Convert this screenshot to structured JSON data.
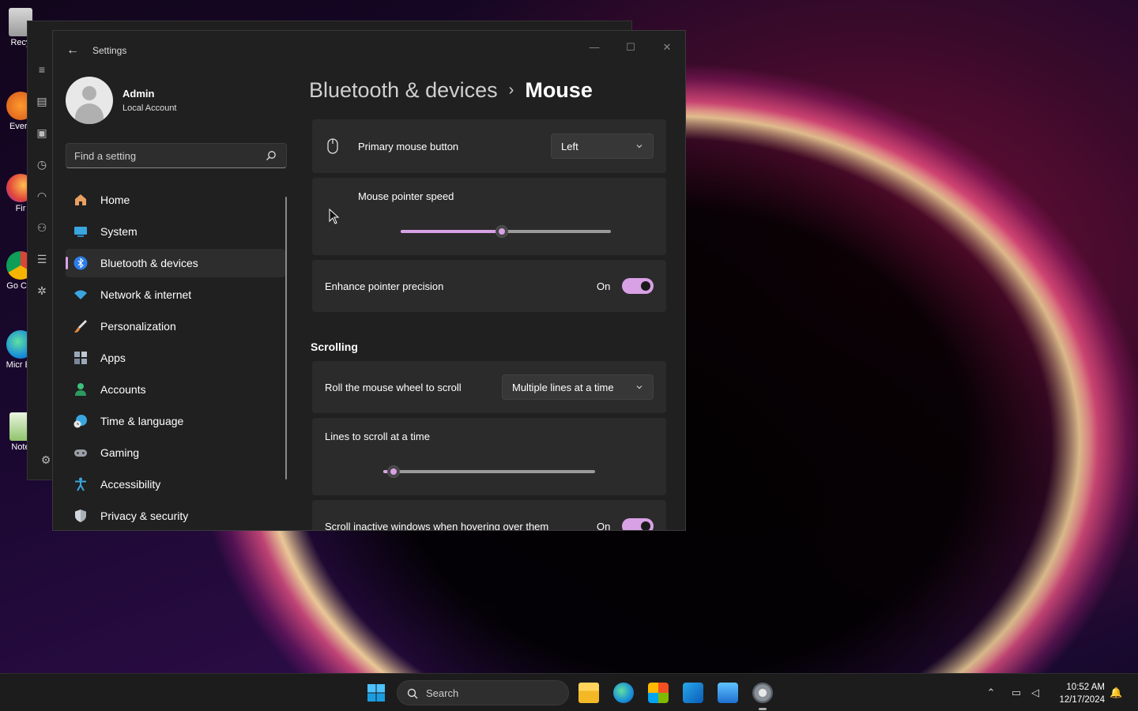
{
  "desktop": {
    "icons": [
      {
        "label": "Recy"
      },
      {
        "label": "Every"
      },
      {
        "label": "Fir"
      },
      {
        "label": "Go Chr"
      },
      {
        "label": "Micr Ec"
      },
      {
        "label": "Note"
      }
    ]
  },
  "window": {
    "title": "Settings",
    "minimize_glyph": "—",
    "maximize_glyph": "☐",
    "close_glyph": "✕",
    "back_glyph": "←"
  },
  "profile": {
    "name": "Admin",
    "account_type": "Local Account"
  },
  "search": {
    "placeholder": "Find a setting"
  },
  "nav": {
    "items": [
      {
        "label": "Home",
        "icon": "home-icon"
      },
      {
        "label": "System",
        "icon": "system-icon"
      },
      {
        "label": "Bluetooth & devices",
        "icon": "bluetooth-icon",
        "selected": true
      },
      {
        "label": "Network & internet",
        "icon": "wifi-icon"
      },
      {
        "label": "Personalization",
        "icon": "brush-icon"
      },
      {
        "label": "Apps",
        "icon": "apps-icon"
      },
      {
        "label": "Accounts",
        "icon": "accounts-icon"
      },
      {
        "label": "Time & language",
        "icon": "globe-clock-icon"
      },
      {
        "label": "Gaming",
        "icon": "gamepad-icon"
      },
      {
        "label": "Accessibility",
        "icon": "accessibility-icon"
      },
      {
        "label": "Privacy & security",
        "icon": "shield-icon"
      }
    ]
  },
  "breadcrumb": {
    "parent": "Bluetooth & devices",
    "separator": "›",
    "current": "Mouse"
  },
  "settings": {
    "primary_button": {
      "label": "Primary mouse button",
      "value": "Left"
    },
    "pointer_speed": {
      "label": "Mouse pointer speed",
      "value_fraction": 0.48
    },
    "enhance_precision": {
      "label": "Enhance pointer precision",
      "state": "On"
    },
    "scrolling_section": "Scrolling",
    "roll_wheel": {
      "label": "Roll the mouse wheel to scroll",
      "value": "Multiple lines at a time"
    },
    "lines_to_scroll": {
      "label": "Lines to scroll at a time",
      "value_fraction": 0.05
    },
    "scroll_inactive": {
      "label": "Scroll inactive windows when hovering over them",
      "state": "On"
    }
  },
  "taskbar": {
    "search_label": "Search",
    "apps": [
      "file-explorer-icon",
      "edge-icon",
      "store-icon",
      "outlook-icon",
      "photos-icon",
      "settings-icon"
    ],
    "time": "10:52 AM",
    "date": "12/17/2024"
  },
  "colors": {
    "accent": "#d9a1e5",
    "window_bg": "#202020",
    "card_bg": "#2b2b2b"
  }
}
